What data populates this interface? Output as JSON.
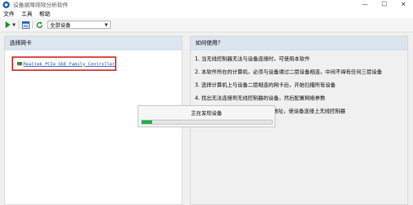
{
  "window": {
    "title": "设备故障排除分析软件",
    "controls": {
      "minimize": "—",
      "maximize": "☐",
      "close": "✕"
    }
  },
  "menu": {
    "items": [
      "文件",
      "工具",
      "帮助"
    ]
  },
  "toolbar": {
    "device_select": {
      "value": "全部设备"
    }
  },
  "left_panel": {
    "header": "选择网卡",
    "adapter": {
      "label": "Realtek PCIe GbE Family Controller"
    }
  },
  "right_panel": {
    "header": "如何使用？",
    "steps": [
      "1. 当无线控制器无法与设备连接时，可使用本软件",
      "2. 本软件所在的计算机，必须与设备通过二层设备相连，中间不得有任何三层设备",
      "3. 选择计算机上与设备二层相连的网卡后，开始扫描所有设备",
      "4. 找出无法连接到无线控制器的设备，然后配置网络参数",
      "5. 配置设备IP或者配置无线控制器地址，使设备连接上无线控制器"
    ]
  },
  "progress": {
    "text": "正在发现设备",
    "value": 0.08,
    "color": "#21b14b"
  }
}
